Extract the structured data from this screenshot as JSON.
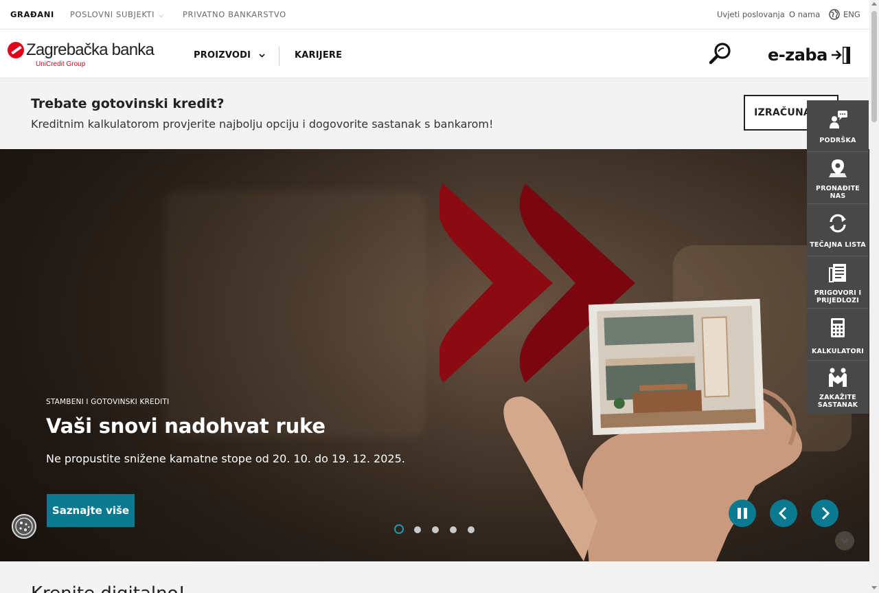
{
  "topbar": {
    "segments": [
      {
        "label": "GRAĐANI",
        "active": true
      },
      {
        "label": "POSLOVNI SUBJEKTI",
        "has_dropdown": true
      },
      {
        "label": "PRIVATNO BANKARSTVO"
      }
    ],
    "links": {
      "terms": "Uvjeti poslovanja",
      "about": "O nama"
    },
    "language": {
      "label": "ENG",
      "icon": "globe-icon"
    }
  },
  "header": {
    "logo": {
      "name": "Zagrebačka banka",
      "group": "UniCredit Group",
      "brand_color": "#e2001a"
    },
    "nav": [
      {
        "label": "PROIZVODI",
        "has_dropdown": true
      },
      {
        "label": "KARIJERE"
      }
    ],
    "search_icon": "search-icon",
    "login": {
      "label": "e-zaba",
      "icon": "login-icon"
    }
  },
  "promo": {
    "title": "Trebate gotovinski kredit?",
    "text": "Kreditnim kalkulatorom provjerite najbolju opciju i dogovorite sastanak s bankarom!",
    "button": "IZRAČUNAJTE"
  },
  "hero": {
    "eyebrow": "STAMBENI I GOTOVINSKI KREDITI",
    "title": "Vaši snovi nadohvat ruke",
    "subtitle": "Ne propustite snižene kamatne stope od 20. 10. do 19. 12. 2025.",
    "cta": "Saznajte više",
    "slides_total": 5,
    "active_slide": 1,
    "accent_color": "#0b7a91",
    "controls": {
      "pause": "pause-icon",
      "prev": "chevron-left-icon",
      "next": "chevron-right-icon"
    }
  },
  "sidebar": {
    "items": [
      {
        "label": "PODRŠKA",
        "icon": "support-chat-icon"
      },
      {
        "label": "PRONAĐITE NAS",
        "icon": "location-pin-icon"
      },
      {
        "label": "TEČAJNA LISTA",
        "icon": "exchange-rate-icon"
      },
      {
        "label": "PRIGOVORI I PRIJEDLOZI",
        "icon": "feedback-document-icon"
      },
      {
        "label": "KALKULATORI",
        "icon": "calculator-icon"
      },
      {
        "label": "ZAKAŽITE SASTANAK",
        "icon": "meeting-icon"
      }
    ]
  },
  "section": {
    "title": "Krenite digitalno!"
  },
  "cookie": {
    "icon": "cookie-icon"
  }
}
